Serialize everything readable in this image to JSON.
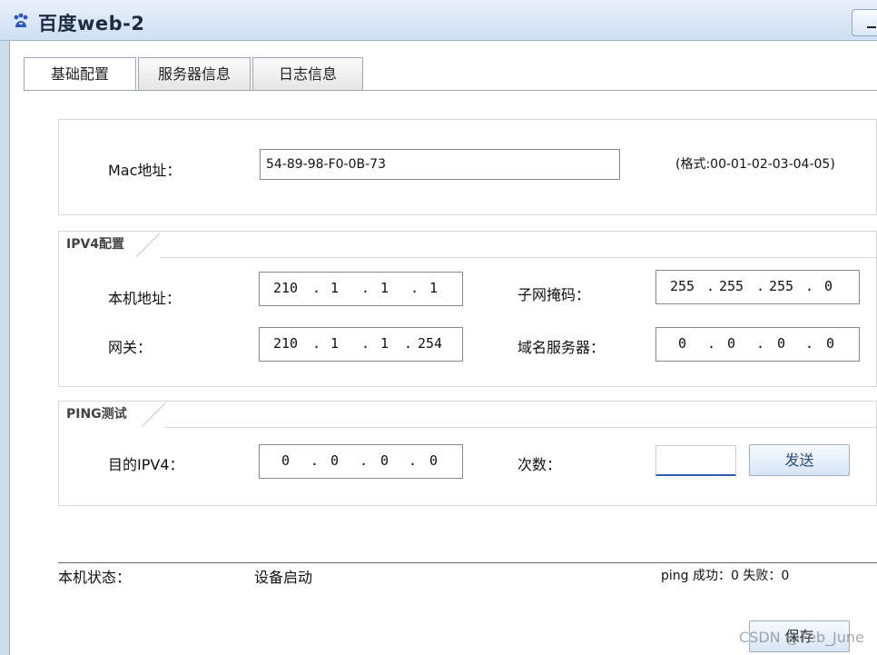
{
  "window": {
    "title": "百度web-2",
    "app_icon": "baidu-paw-icon"
  },
  "tabs": [
    {
      "label": "基础配置",
      "active": true
    },
    {
      "label": "服务器信息",
      "active": false
    },
    {
      "label": "日志信息",
      "active": false
    }
  ],
  "mac": {
    "label": "Mac地址：",
    "value": "54-89-98-F0-0B-73",
    "hint": "(格式:00-01-02-03-04-05)"
  },
  "ipv4": {
    "legend": "IPV4配置",
    "host_label": "本机地址：",
    "host_ip": [
      "210",
      "1",
      "1",
      "1"
    ],
    "mask_label": "子网掩码：",
    "mask_ip": [
      "255",
      "255",
      "255",
      "0"
    ],
    "gateway_label": "网关：",
    "gateway_ip": [
      "210",
      "1",
      "1",
      "254"
    ],
    "dns_label": "域名服务器：",
    "dns_ip": [
      "0",
      "0",
      "0",
      "0"
    ]
  },
  "ping": {
    "legend": "PING测试",
    "target_label": "目的IPV4：",
    "target_ip": [
      "0",
      "0",
      "0",
      "0"
    ],
    "count_label": "次数：",
    "count_value": "",
    "send_button": "发送"
  },
  "status": {
    "label": "本机状态：",
    "value": "设备启动",
    "ping_result": "ping 成功：0 失败：0"
  },
  "save_button": "保存",
  "watermark": "CSDN @Feb_June"
}
